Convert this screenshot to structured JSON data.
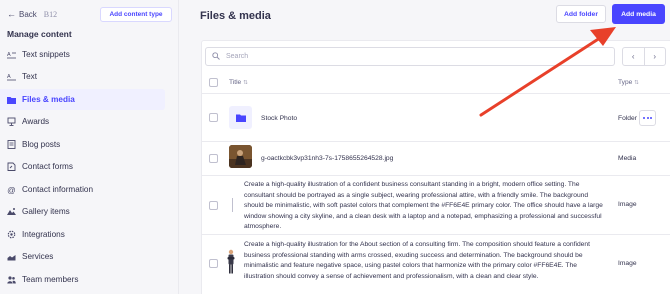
{
  "sidebar": {
    "back_label": "Back",
    "site_name": "B12",
    "add_content_type": "Add content type",
    "section_title": "Manage content",
    "items": [
      {
        "label": "Text snippets",
        "icon": "text-snippet-icon"
      },
      {
        "label": "Text",
        "icon": "text-icon"
      },
      {
        "label": "Files & media",
        "icon": "folder-icon"
      },
      {
        "label": "Awards",
        "icon": "award-icon"
      },
      {
        "label": "Blog posts",
        "icon": "blog-icon"
      },
      {
        "label": "Contact forms",
        "icon": "form-icon"
      },
      {
        "label": "Contact information",
        "icon": "at-icon"
      },
      {
        "label": "Gallery items",
        "icon": "gallery-icon"
      },
      {
        "label": "Integrations",
        "icon": "integrations-icon"
      },
      {
        "label": "Services",
        "icon": "services-icon"
      },
      {
        "label": "Team members",
        "icon": "team-icon"
      }
    ],
    "active_index": 2
  },
  "main": {
    "title": "Files & media",
    "add_folder": "Add folder",
    "add_media": "Add media",
    "search_placeholder": "Search",
    "columns": {
      "title": "Title",
      "type": "Type"
    },
    "rows": [
      {
        "name": "Stock Photo",
        "type": "Folder"
      },
      {
        "name": "g-oactkcbk3vp31nh3-7s-1758655264528.jpg",
        "type": "Media"
      },
      {
        "name": "Create a high-quality illustration of a confident business consultant standing in a bright, modern office setting. The consultant should be portrayed as a single subject, wearing professional attire, with a friendly smile. The background should be minimalistic, with soft pastel colors that complement the #FF6E4E primary color. The office should have a large window showing a city skyline, and a clean desk with a laptop and a notepad, emphasizing a professional and successful atmosphere.",
        "type": "Image"
      },
      {
        "name": "Create a high-quality illustration for the About section of a consulting firm. The composition should feature a confident business professional standing with arms crossed, exuding success and determination. The background should be minimalistic and feature negative space, using pastel colors that harmonize with the primary color #FF6E4E. The illustration should convey a sense of achievement and professionalism, with a clean and clear style.",
        "type": "Image"
      }
    ]
  },
  "colors": {
    "accent": "#4945ff",
    "annotation_arrow": "#e8402a"
  }
}
